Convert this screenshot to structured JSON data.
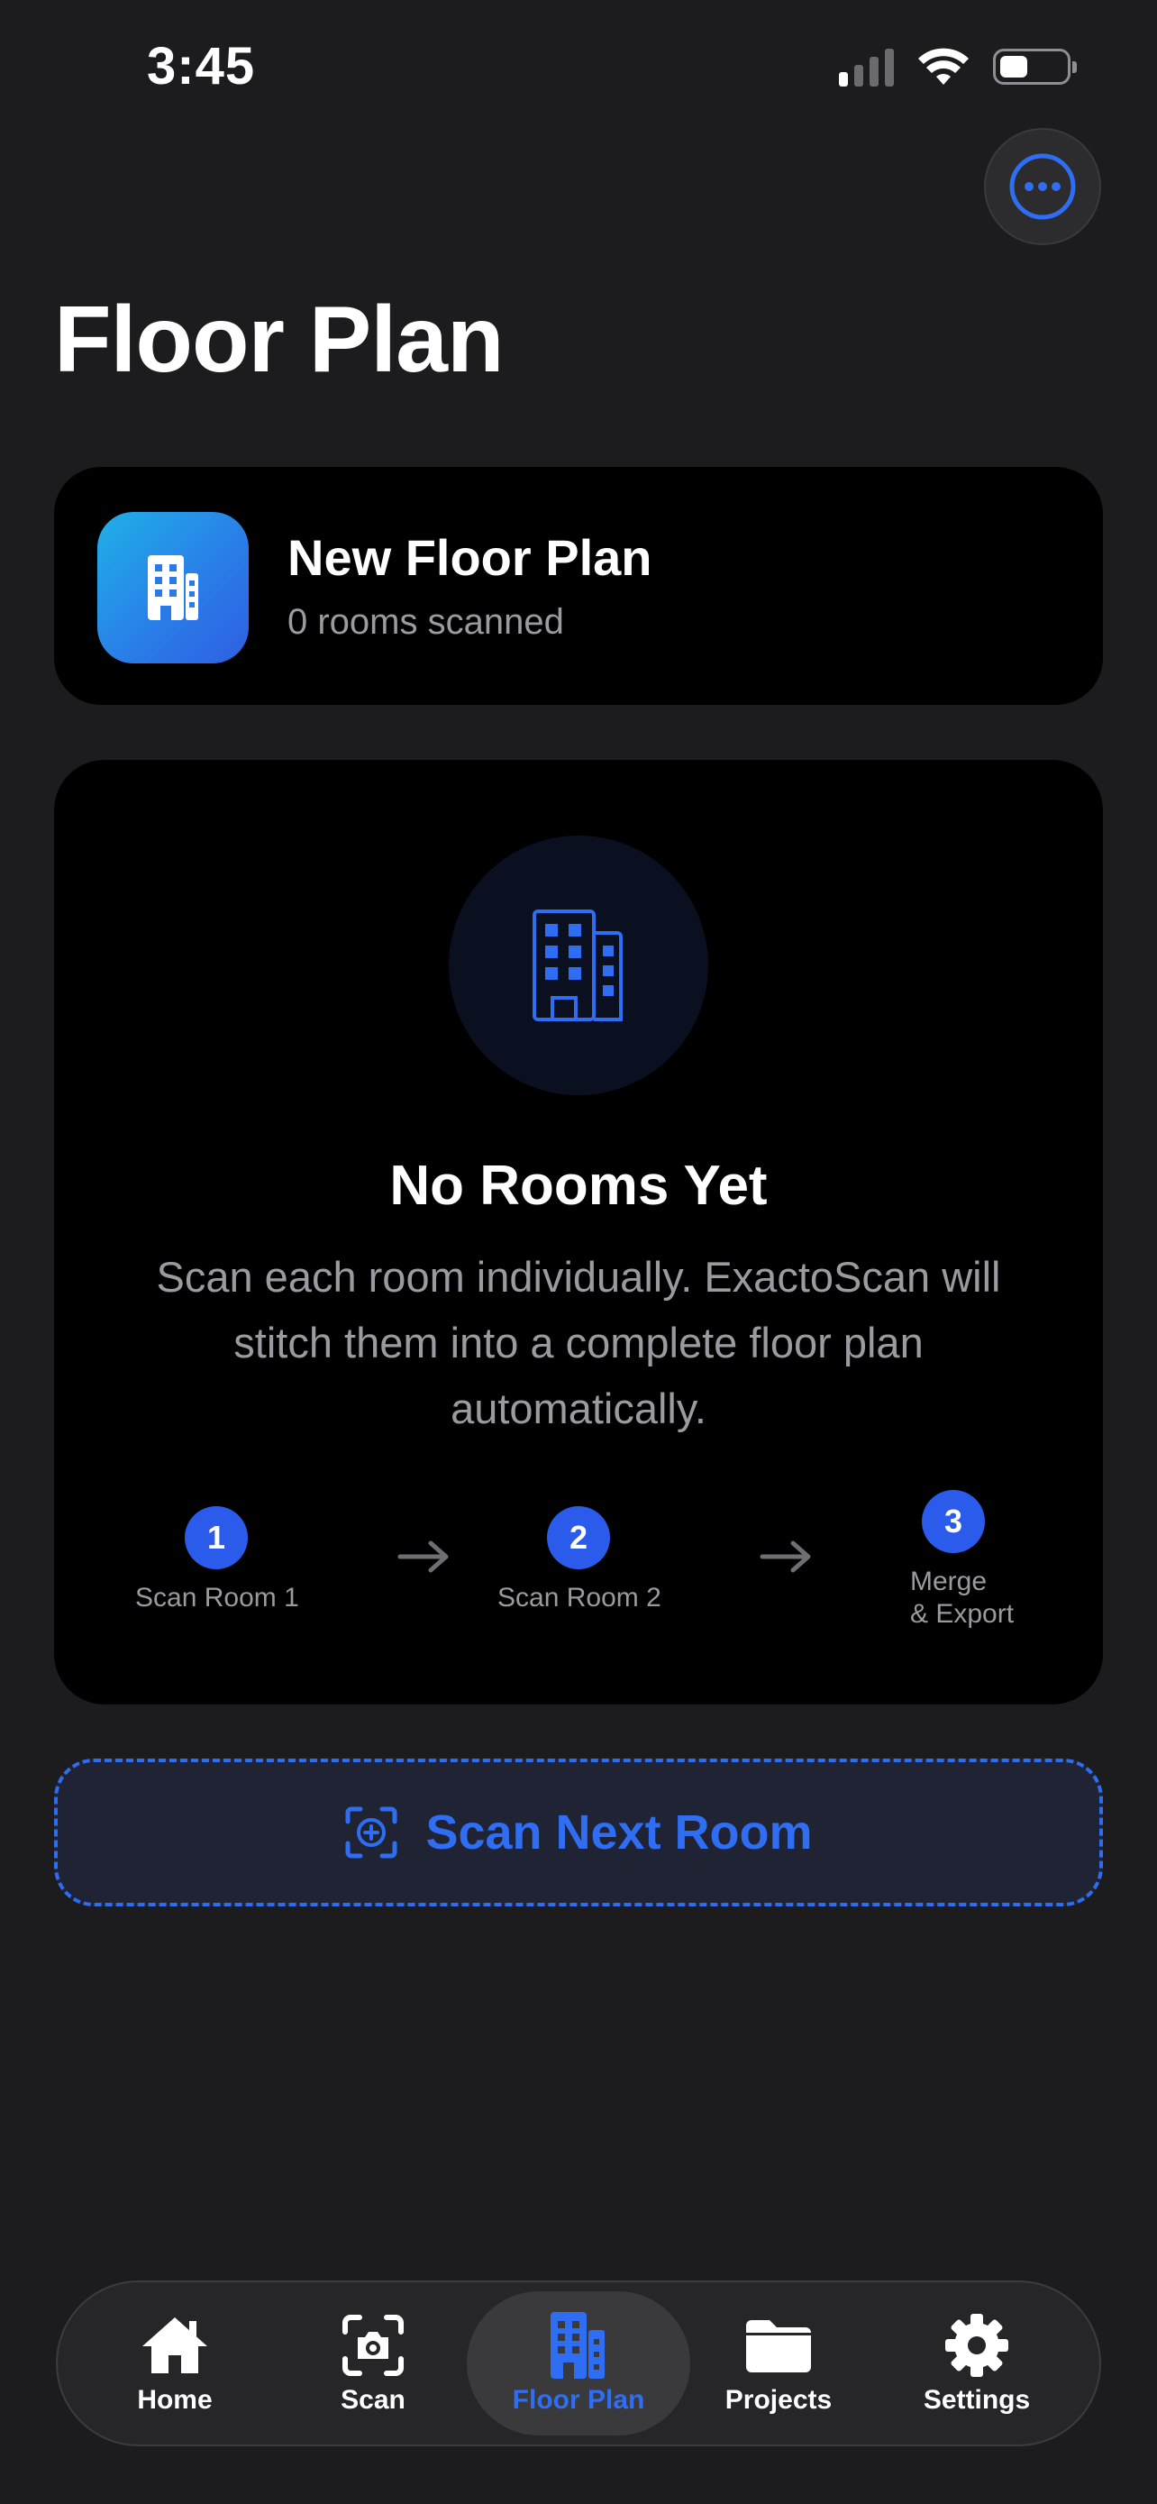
{
  "status_bar": {
    "time": "3:45",
    "signal_bars_active": 1,
    "battery_level": 0.35
  },
  "header": {
    "title": "Floor Plan",
    "more_icon": "ellipsis-circle-icon"
  },
  "plan_card": {
    "name": "New Floor Plan",
    "subtitle": "0 rooms scanned",
    "icon": "building-icon"
  },
  "empty_state": {
    "icon": "building-icon",
    "title": "No Rooms Yet",
    "description": "Scan each room individually. ExactoScan will stitch them into a complete floor plan automatically.",
    "steps": [
      {
        "number": "1",
        "label": "Scan Room 1"
      },
      {
        "number": "2",
        "label": "Scan Room 2"
      },
      {
        "number": "3",
        "label": "Merge\n& Export"
      }
    ]
  },
  "scan_next": {
    "label": "Scan Next Room",
    "icon": "viewfinder-plus-icon"
  },
  "tab_bar": {
    "active": "floor-plan",
    "tabs": [
      {
        "id": "home",
        "label": "Home",
        "icon": "house-icon"
      },
      {
        "id": "scan",
        "label": "Scan",
        "icon": "camera-viewfinder-icon"
      },
      {
        "id": "floor-plan",
        "label": "Floor Plan",
        "icon": "building-icon"
      },
      {
        "id": "projects",
        "label": "Projects",
        "icon": "folder-icon"
      },
      {
        "id": "settings",
        "label": "Settings",
        "icon": "gear-icon"
      }
    ]
  },
  "colors": {
    "accent": "#2f6df2",
    "background": "#1c1c1e",
    "card": "#000000",
    "secondary_text": "#9a9aa0"
  }
}
